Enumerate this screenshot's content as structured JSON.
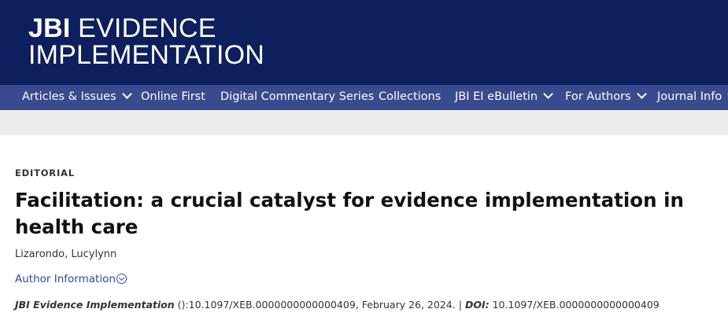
{
  "header": {
    "logo_bold": "JBI",
    "logo_rest": " EVIDENCE",
    "logo_line2": "IMPLEMENTATION"
  },
  "nav": {
    "items": [
      {
        "label": "Articles & Issues",
        "has_dropdown": true
      },
      {
        "label": "Online First",
        "has_dropdown": false
      },
      {
        "label": "Digital Commentary Series",
        "has_dropdown": false
      },
      {
        "label": "Collections",
        "has_dropdown": false
      },
      {
        "label": "JBI EI eBulletin",
        "has_dropdown": true
      },
      {
        "label": "For Authors",
        "has_dropdown": true
      },
      {
        "label": "Journal Info",
        "has_dropdown": true
      }
    ]
  },
  "article": {
    "type": "EDITORIAL",
    "title": "Facilitation: a crucial catalyst for evidence implementation in health care",
    "authors": "Lizarondo, Lucylynn",
    "author_info_label": "Author Information",
    "citation": {
      "journal": "JBI Evidence Implementation",
      "details": " ():10.1097/XEB.0000000000000409, February 26, 2024.",
      "separator": "|",
      "doi_label": "DOI:",
      "doi_value": " 10.1097/XEB.0000000000000409"
    }
  },
  "colors": {
    "header_bg": "#0d1f5c",
    "nav_bg": "#3a4a8e",
    "link": "#2b4b9b"
  }
}
